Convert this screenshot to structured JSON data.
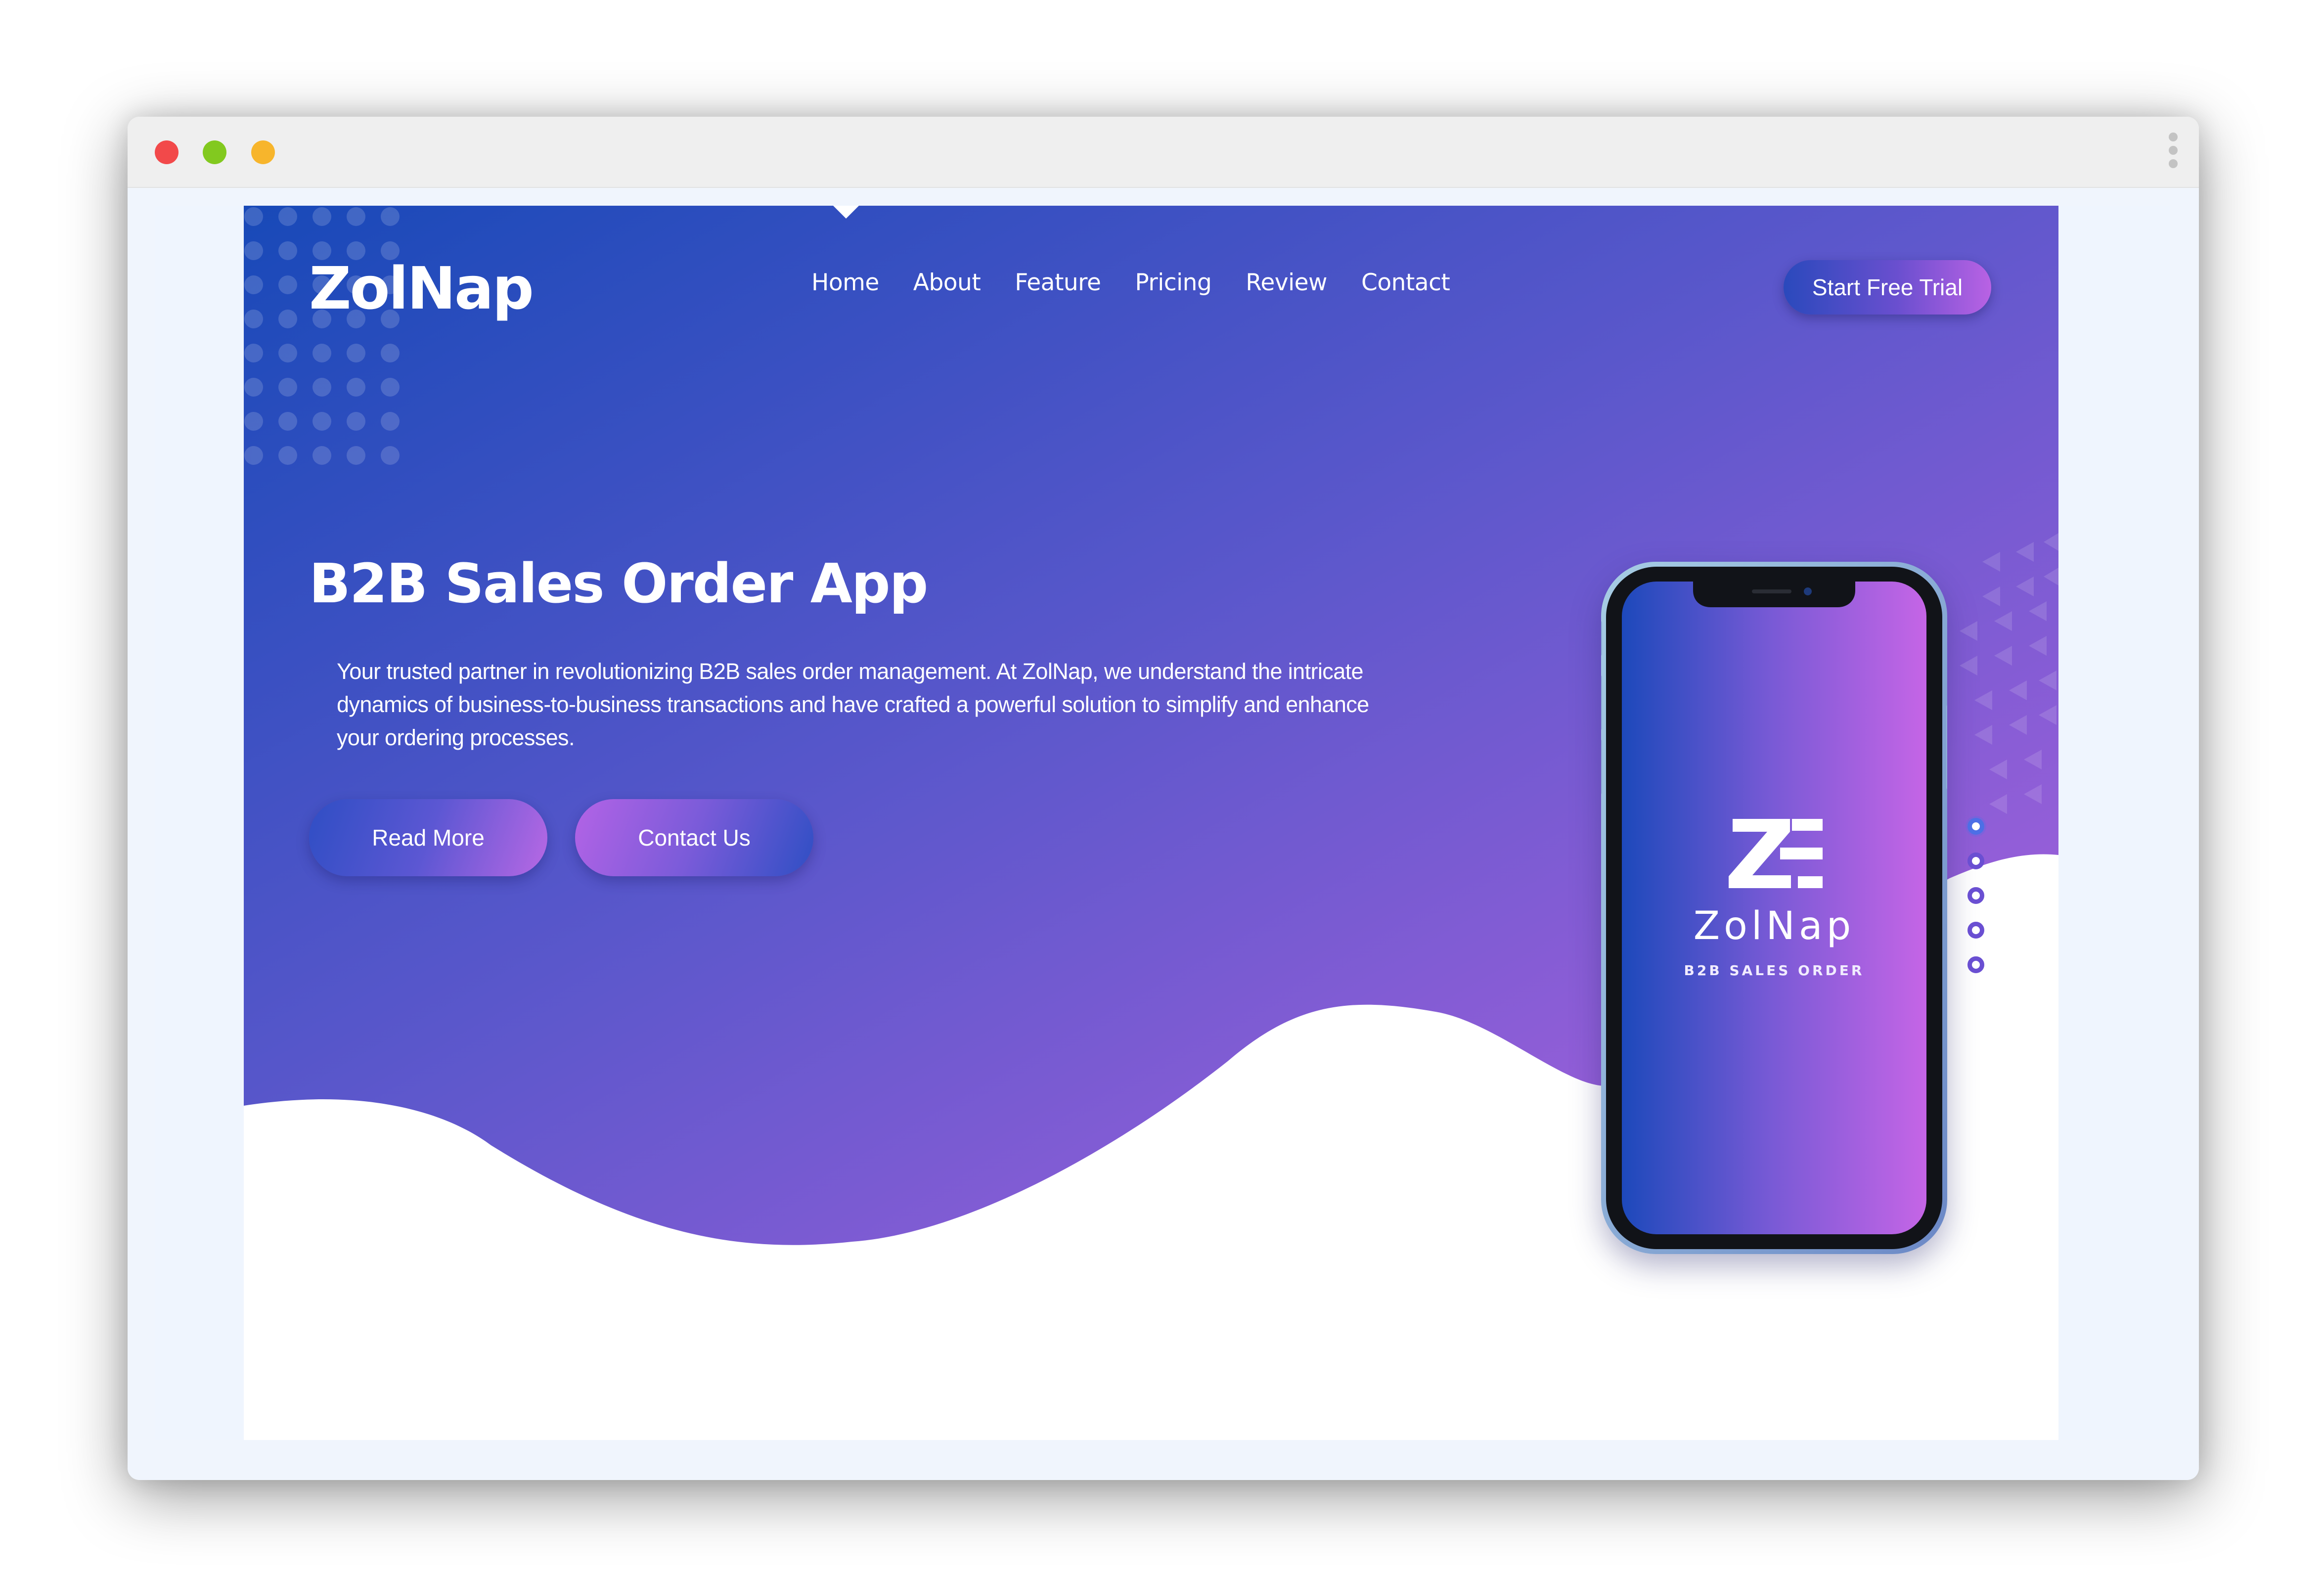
{
  "brand": {
    "logo_text": "ZolNap",
    "colors": {
      "primary": "#1a4bba",
      "accent": "#b963e6",
      "mid": "#6a57d1"
    }
  },
  "nav": {
    "items": [
      {
        "label": "Home"
      },
      {
        "label": "About"
      },
      {
        "label": "Feature"
      },
      {
        "label": "Pricing"
      },
      {
        "label": "Review"
      },
      {
        "label": "Contact"
      }
    ],
    "cta_label": "Start Free Trial"
  },
  "hero": {
    "title": "B2B Sales Order App",
    "description": "Your trusted partner in revolutionizing B2B sales order management. At ZolNap, we understand the intricate dynamics of business-to-business transactions and have crafted a powerful solution to simplify and enhance your ordering processes.",
    "primary_button": "Read More",
    "secondary_button": "Contact Us"
  },
  "phone": {
    "app_name": "ZolNap",
    "app_tagline": "B2B SALES ORDER"
  },
  "slider": {
    "total": 5,
    "active_index": 0
  },
  "window": {
    "controls": [
      "close",
      "minimize",
      "maximize"
    ],
    "menu_icon": "kebab-menu-icon"
  }
}
